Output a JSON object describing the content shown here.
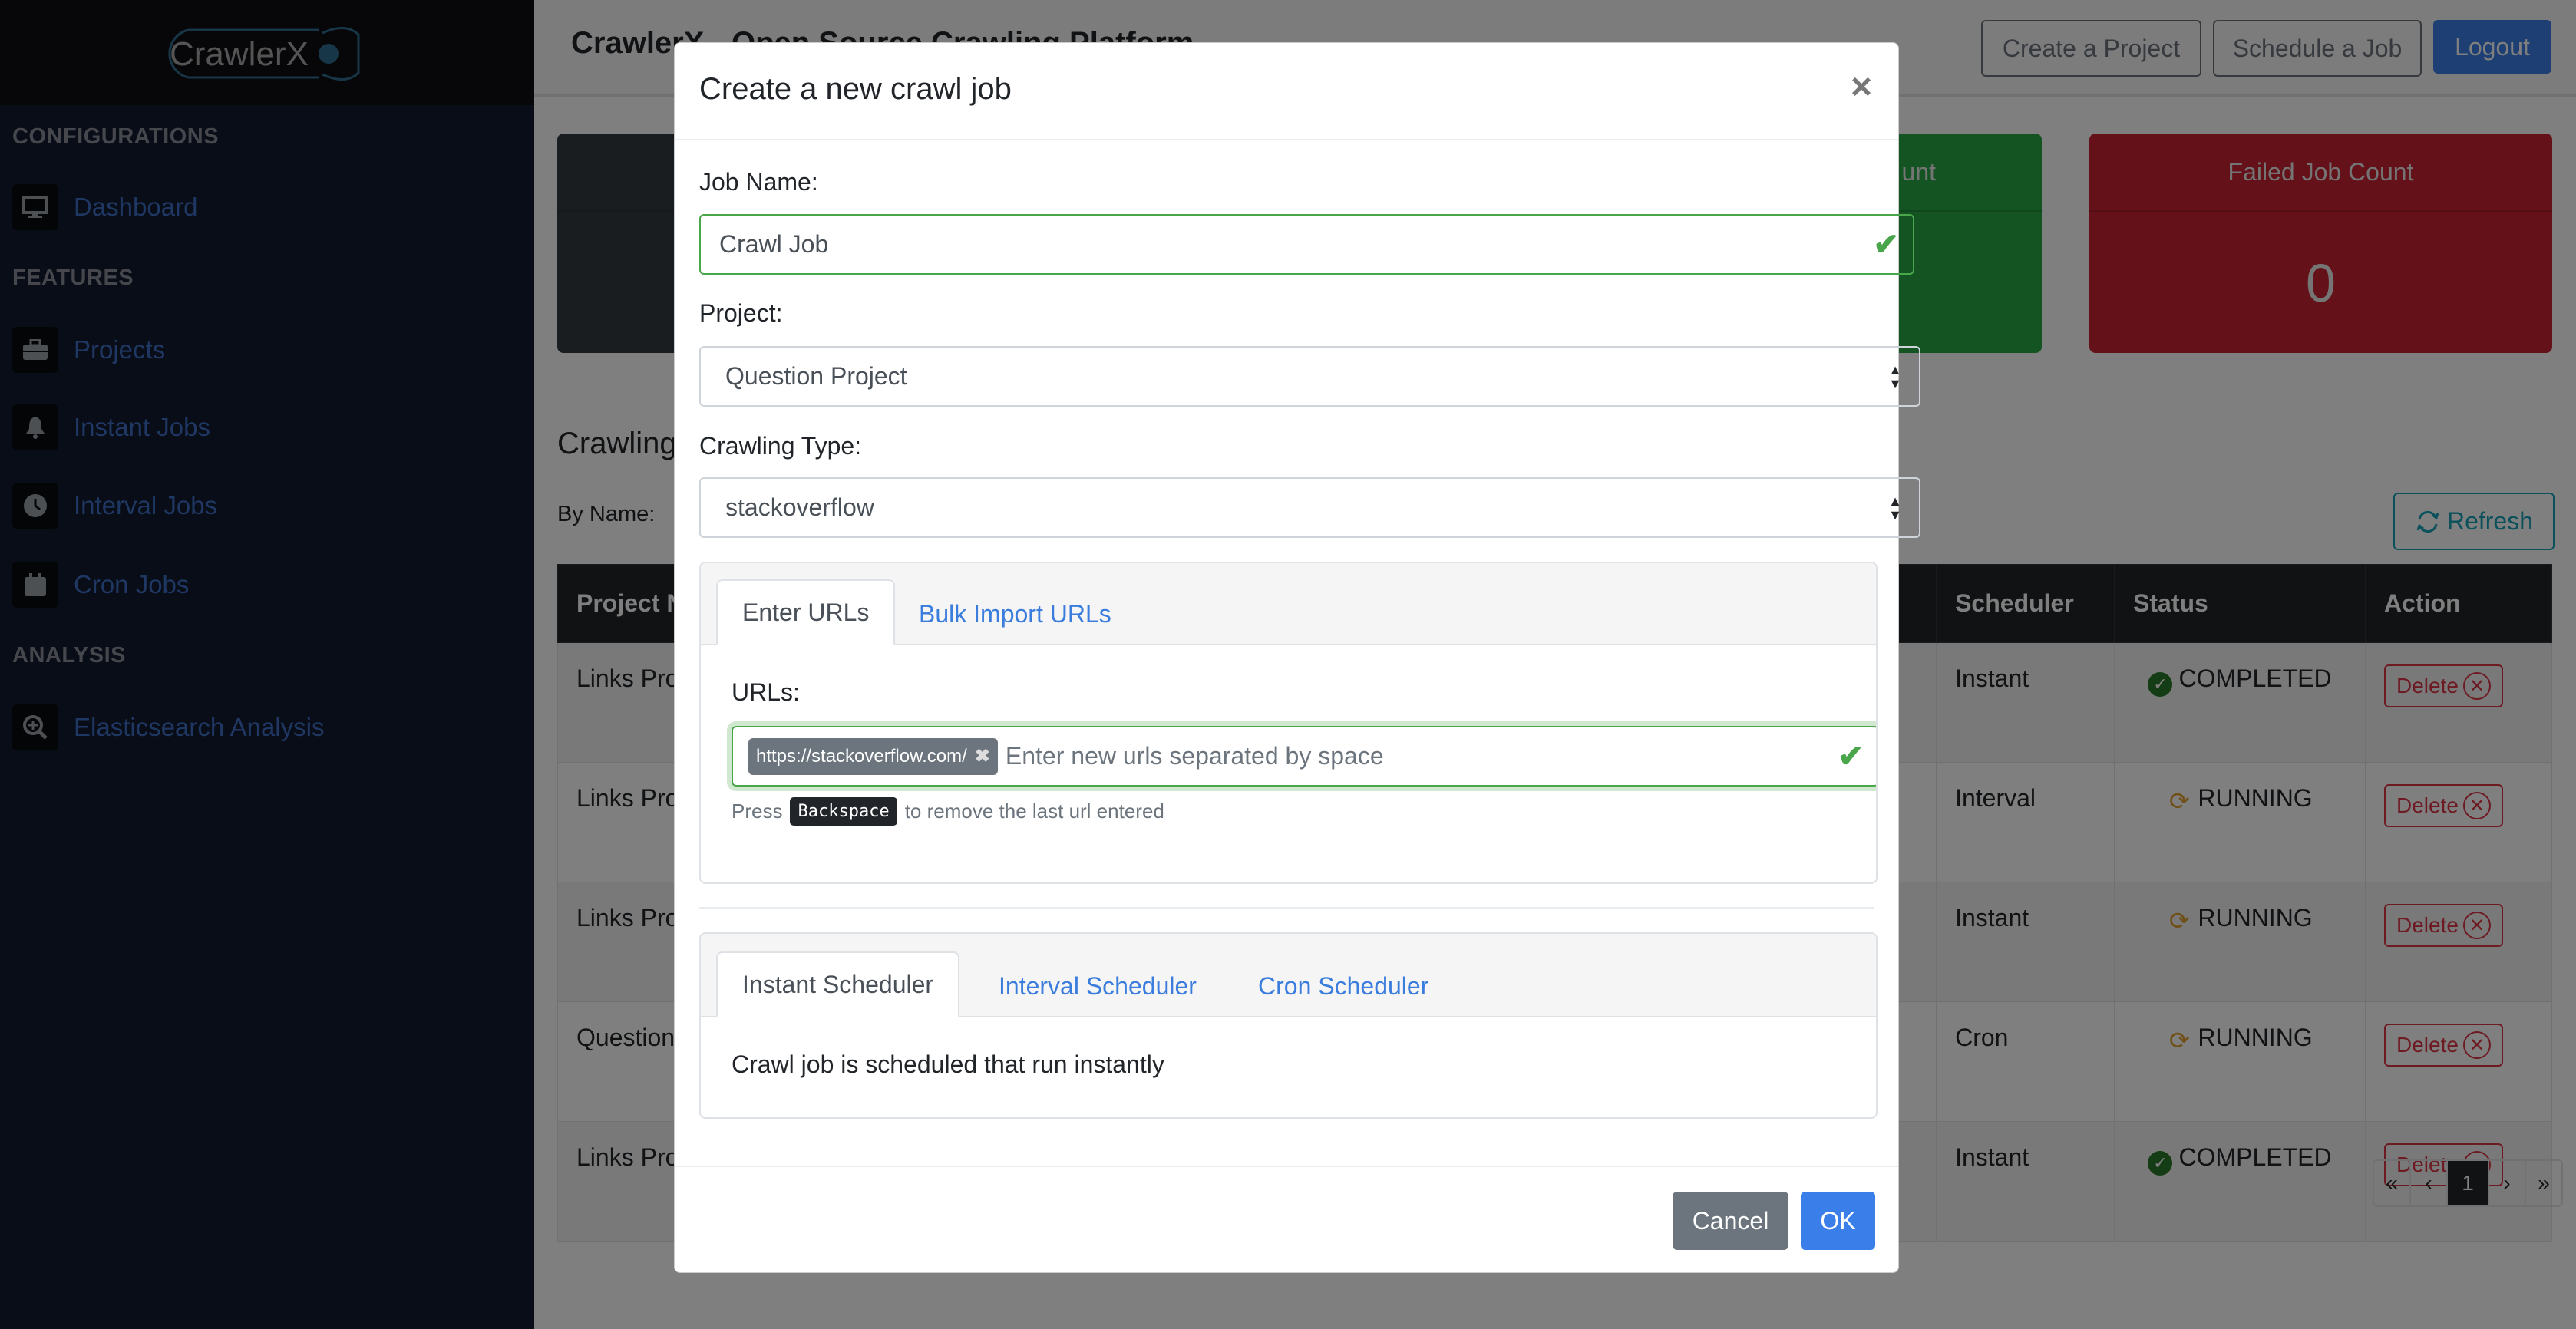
{
  "app": {
    "logo_text": "CrawlerX",
    "header_title": "CrawlerX - Open Source Crawling Platform"
  },
  "sidebar": {
    "sections": [
      {
        "label": "CONFIGURATIONS",
        "items": [
          {
            "label": "Dashboard",
            "icon": "monitor-icon",
            "active": true
          }
        ]
      },
      {
        "label": "FEATURES",
        "items": [
          {
            "label": "Projects",
            "icon": "briefcase-icon"
          },
          {
            "label": "Instant Jobs",
            "icon": "bell-icon"
          },
          {
            "label": "Interval Jobs",
            "icon": "clock-icon"
          },
          {
            "label": "Cron Jobs",
            "icon": "calendar-icon"
          }
        ]
      },
      {
        "label": "ANALYSIS",
        "items": [
          {
            "label": "Elasticsearch Analysis",
            "icon": "zoom-in-icon"
          }
        ]
      }
    ]
  },
  "topbar": {
    "create_project": "Create a Project",
    "schedule_job": "Schedule a Job",
    "logout": "Logout"
  },
  "stats": [
    {
      "label": "",
      "value": "",
      "color": "#343a40"
    },
    {
      "label": "unt",
      "value": "",
      "color": "#28a745"
    },
    {
      "label": "Failed Job Count",
      "value": "0",
      "color": "#c82333"
    }
  ],
  "jobs_section": {
    "heading": "Crawling",
    "filter_label": "By Name:",
    "refresh_label": "Refresh",
    "columns": [
      "Project N",
      "Scheduler",
      "Status",
      "Action"
    ],
    "rows": [
      {
        "project": "Links Pro",
        "scheduler": "Instant",
        "status": "COMPLETED",
        "action": "Delete"
      },
      {
        "project": "Links Pro",
        "scheduler": "Interval",
        "status": "RUNNING",
        "action": "Delete"
      },
      {
        "project": "Links Pro",
        "scheduler": "Instant",
        "status": "RUNNING",
        "action": "Delete"
      },
      {
        "project": "Question",
        "scheduler": "Cron",
        "status": "RUNNING",
        "action": "Delete"
      },
      {
        "project": "Links Pro",
        "scheduler": "Instant",
        "status": "COMPLETED",
        "action": "Delete"
      }
    ],
    "pagination": {
      "first": "«",
      "prev": "‹",
      "current": "1",
      "next": "›",
      "last": "»"
    }
  },
  "modal": {
    "title": "Create a new crawl job",
    "close": "×",
    "job_name_label": "Job Name:",
    "job_name_value": "Crawl Job",
    "project_label": "Project:",
    "project_value": "Question Project",
    "crawling_type_label": "Crawling Type:",
    "crawling_type_value": "stackoverflow",
    "url_tabs": [
      "Enter URLs",
      "Bulk Import URLs"
    ],
    "urls_label": "URLs:",
    "url_tags": [
      "https://stackoverflow.com/"
    ],
    "url_placeholder": "Enter new urls separated by space",
    "help_prefix": "Press",
    "help_key": "Backspace",
    "help_suffix": "to remove the last url entered",
    "scheduler_tabs": [
      "Instant Scheduler",
      "Interval Scheduler",
      "Cron Scheduler"
    ],
    "scheduler_text": "Crawl job is scheduled that run instantly",
    "cancel": "Cancel",
    "ok": "OK"
  }
}
